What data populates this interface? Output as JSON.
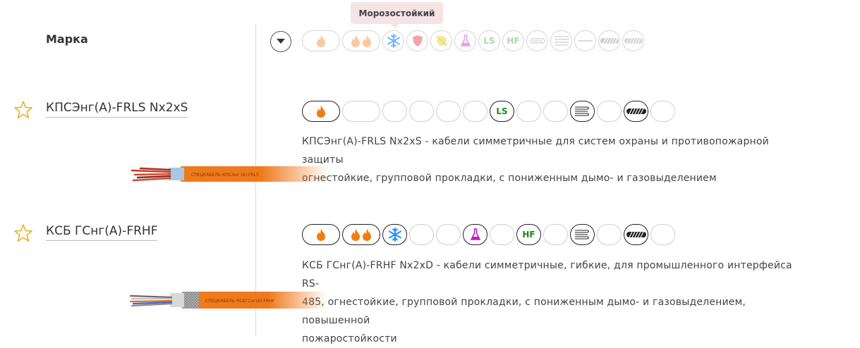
{
  "header": {
    "marka_label": "Марка"
  },
  "tooltip": {
    "text": "Морозостойкий"
  },
  "filters": [
    {
      "name": "fire-resistant-filter",
      "icon": "flame-icon"
    },
    {
      "name": "fire-spread-filter",
      "icon": "double-flame-icon"
    },
    {
      "name": "frost-resistant-filter",
      "icon": "snowflake-icon"
    },
    {
      "name": "protection-filter",
      "icon": "shield-icon"
    },
    {
      "name": "uv-resistant-filter",
      "icon": "sun-crossed-icon"
    },
    {
      "name": "chemical-resistant-filter",
      "icon": "flask-icon"
    },
    {
      "name": "ls-filter",
      "icon": "ls-icon",
      "text": "LS"
    },
    {
      "name": "hf-filter",
      "icon": "hf-icon",
      "text": "HF"
    },
    {
      "name": "flat-cable-filter",
      "icon": "flat-cable-icon"
    },
    {
      "name": "multi-wire-filter",
      "icon": "multi-wire-icon"
    },
    {
      "name": "single-wire-filter",
      "icon": "single-wire-icon"
    },
    {
      "name": "armor-filter",
      "icon": "armor-icon"
    },
    {
      "name": "braid-filter",
      "icon": "braid-icon"
    }
  ],
  "products": [
    {
      "name": "КПСЭнг(А)-FRLS Nx2xS",
      "description_line1": "КПСЭнг(А)-FRLS Nx2xS - кабели симметричные для систем охраны и противопожарной защиты",
      "description_line2": "огнестойкие, групповой прокладки, с пониженным дымо- и газовыделением",
      "ls_text": "LS"
    },
    {
      "name": "КСБ ГСнг(А)-FRHF",
      "description_line1": "КСБ ГСнг(А)-FRHF Nx2xD - кабели симметричные, гибкие, для промышленного интерфейса RS-",
      "description_line2": "485, огнестойкие, групповой прокладки, с пониженным дымо- и газовыделением, повышенной",
      "description_line3": "пожаростойкости",
      "hf_text": "HF"
    }
  ],
  "colors": {
    "accent_orange": "#f07d14",
    "ls_green": "#1a8a1a",
    "flask_purple": "#c020c0",
    "snow_blue": "#1e90ff",
    "star_gold": "#e0b21a"
  }
}
